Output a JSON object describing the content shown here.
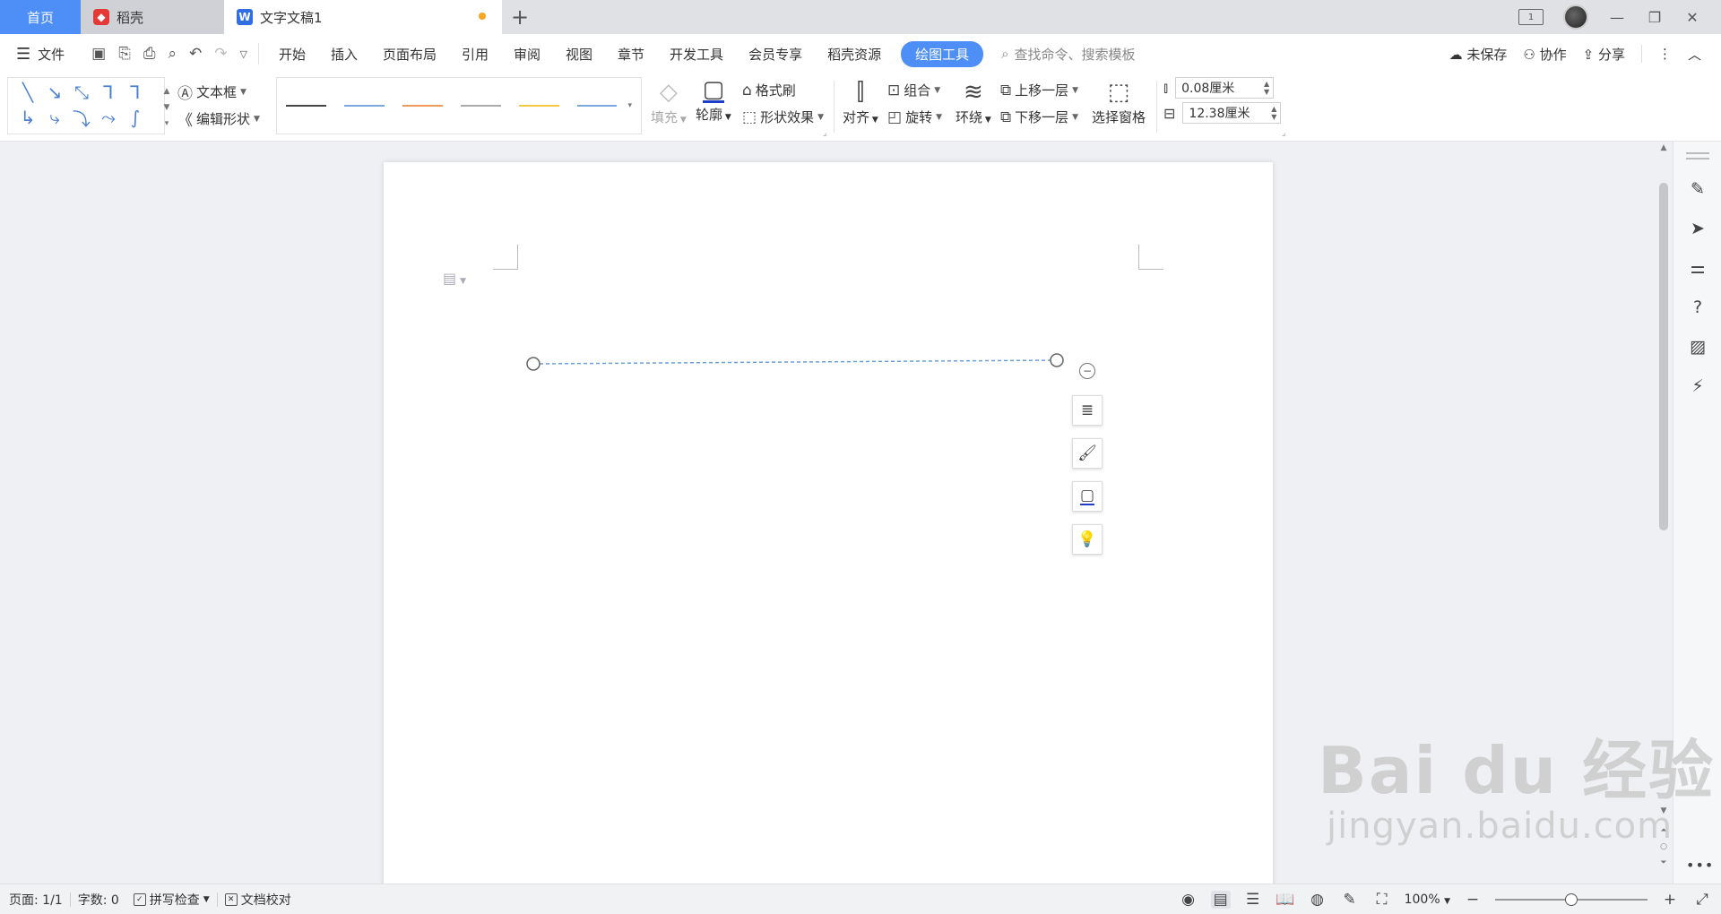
{
  "tabs": {
    "home": "首页",
    "daoke": "稻壳",
    "doc": "文字文稿1",
    "add": "+"
  },
  "window": {
    "layout_label": "1",
    "minimize": "—",
    "restore": "❐",
    "close": "✕"
  },
  "menu": {
    "file": "文件",
    "items": [
      "开始",
      "插入",
      "页面布局",
      "引用",
      "审阅",
      "视图",
      "章节",
      "开发工具",
      "会员专享",
      "稻壳资源"
    ],
    "active": "绘图工具",
    "search_placeholder": "查找命令、搜索模板",
    "unsaved": "未保存",
    "collab": "协作",
    "share": "分享"
  },
  "ribbon": {
    "textbox": "文本框",
    "edit_shape": "编辑形状",
    "line_colors": [
      "#444444",
      "#7aa7de",
      "#f29a5a",
      "#aaaaaa",
      "#f5c842",
      "#7aa7de"
    ],
    "fill": "填充",
    "outline": "轮廓",
    "format_painter": "格式刷",
    "shape_effects": "形状效果",
    "align": "对齐",
    "group": "组合",
    "rotate": "旋转",
    "wrap": "环绕",
    "bring_forward": "上移一层",
    "send_backward": "下移一层",
    "selection_pane": "选择窗格",
    "height_value": "0.08厘米",
    "width_value": "12.38厘米"
  },
  "statusbar": {
    "page": "页面: 1/1",
    "words": "字数: 0",
    "spell": "拼写检查",
    "proof": "文档校对",
    "zoom": "100%",
    "zoom_level": 0.5
  },
  "watermark": {
    "brand": "Bai du 经验",
    "url": "jingyan.baidu.com"
  },
  "colors": {
    "accent": "#4d8ef7",
    "shape_line": "#6aa0d8"
  }
}
